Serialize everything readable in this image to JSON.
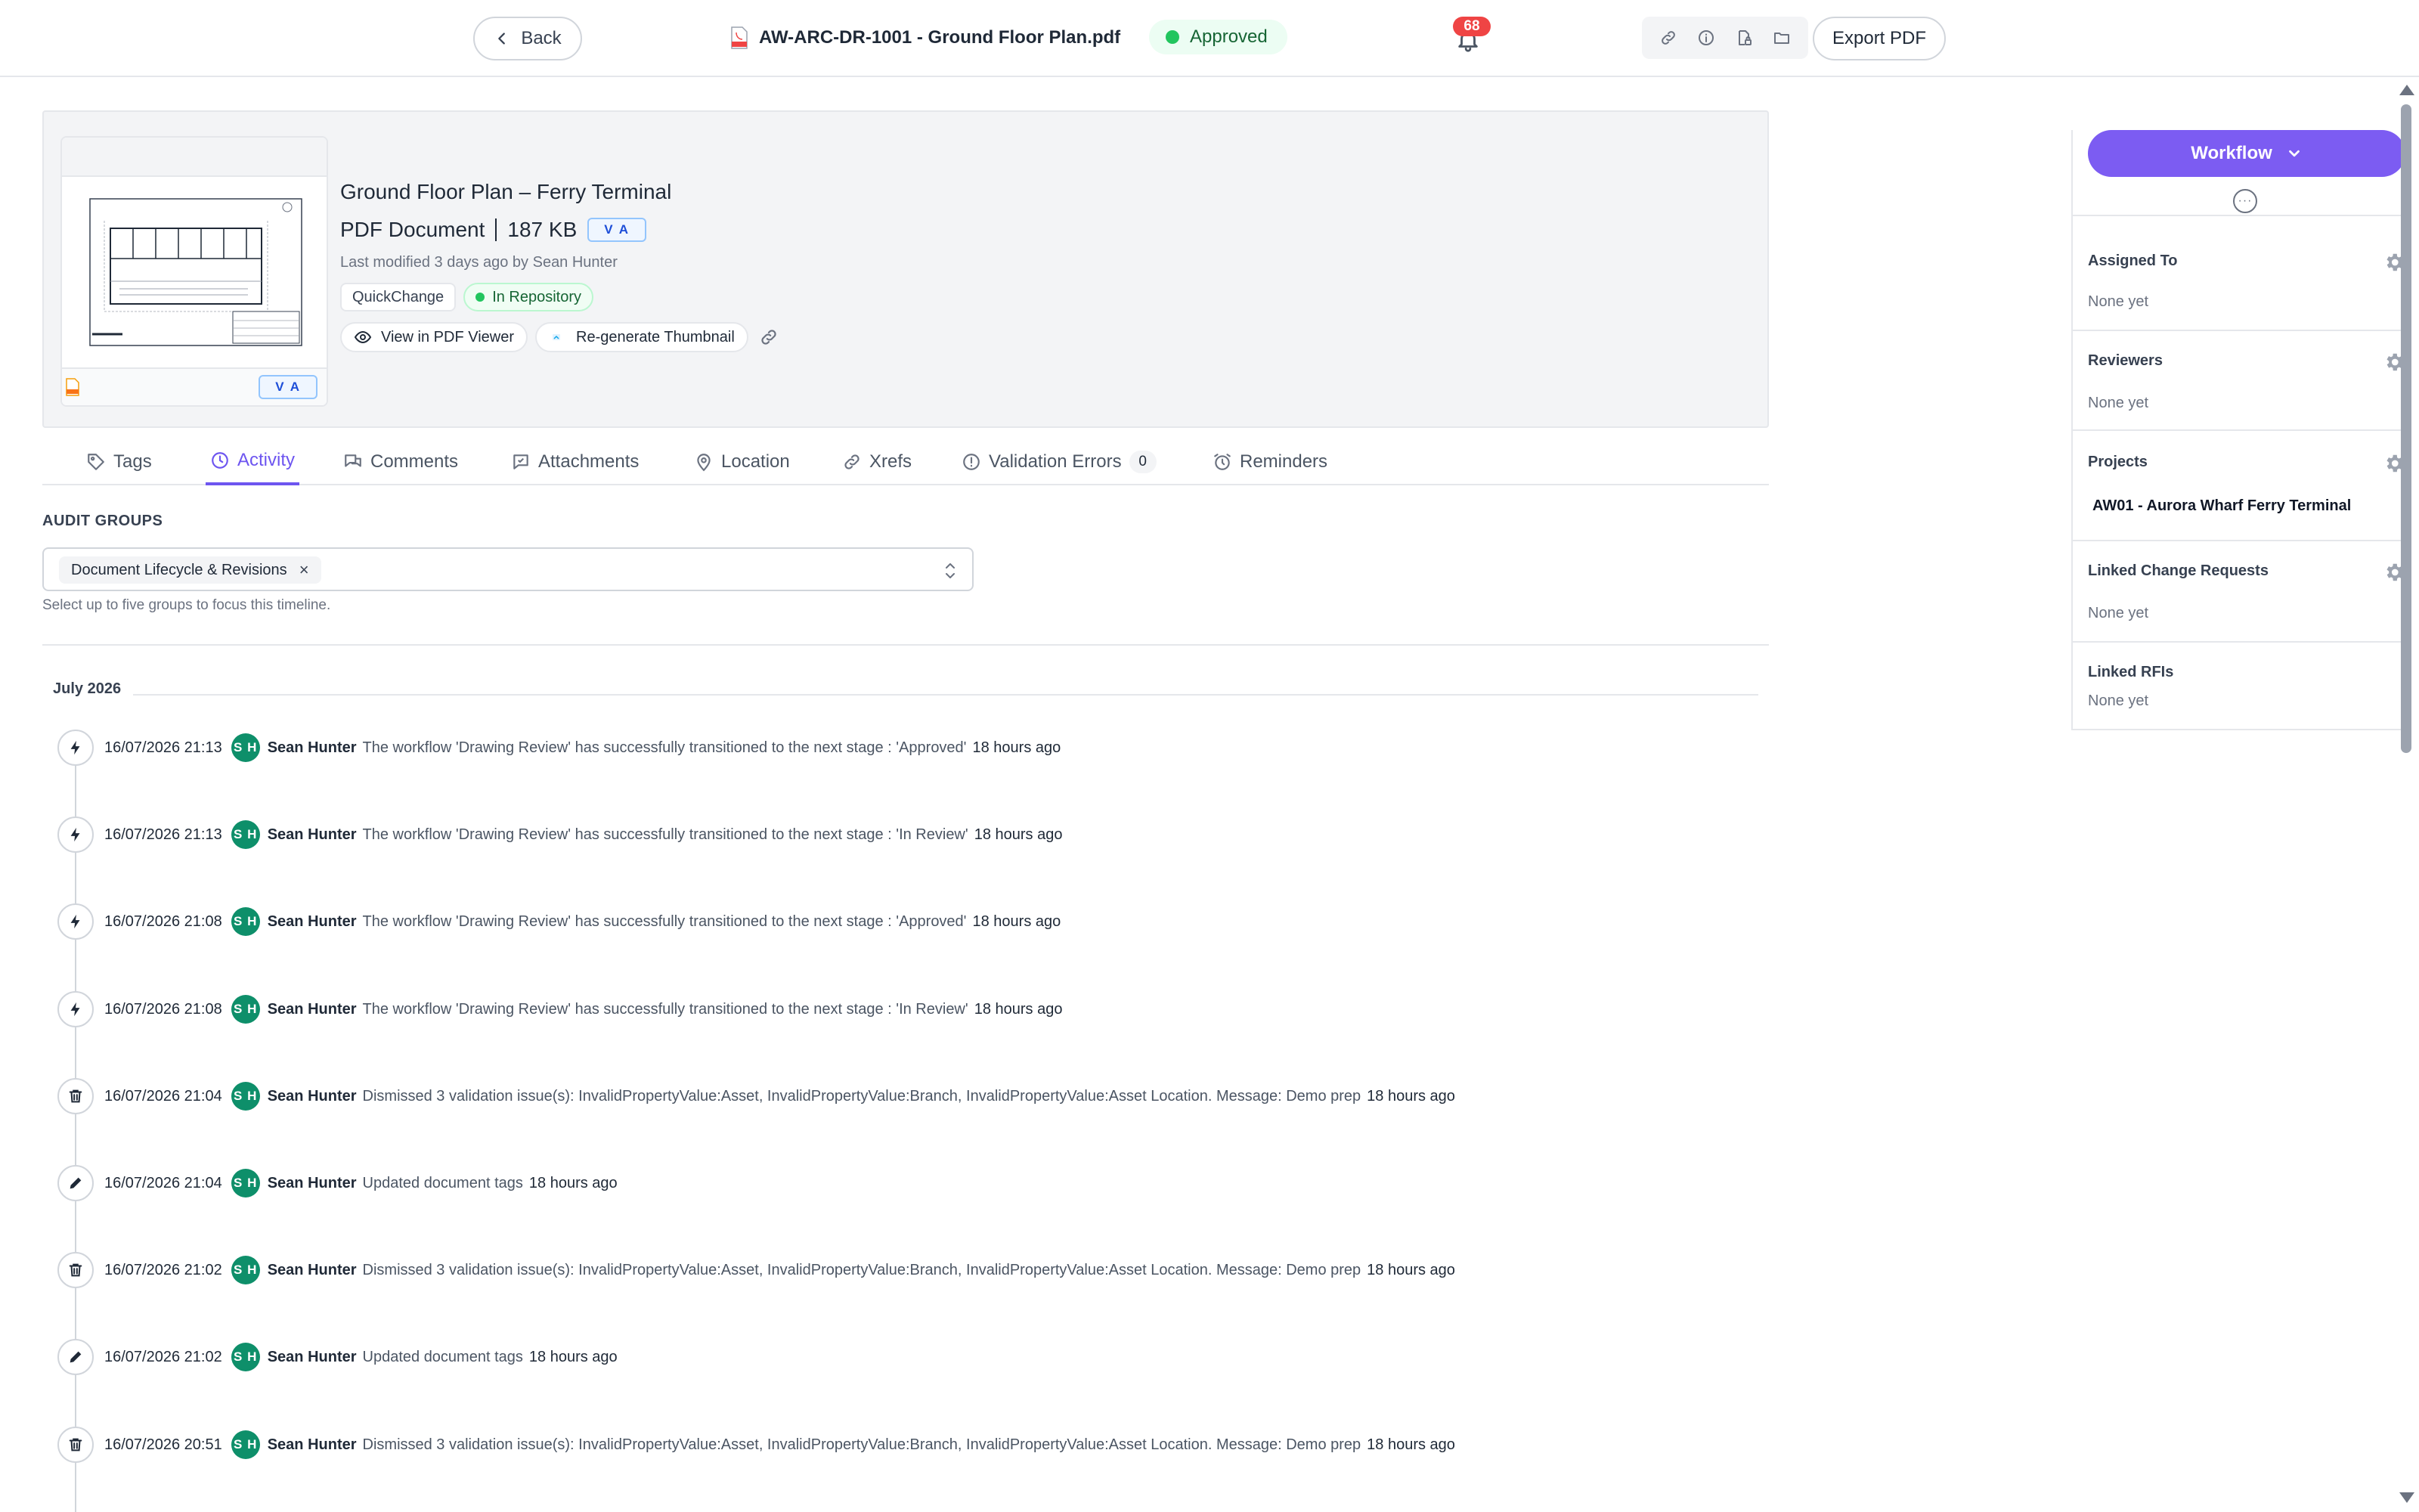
{
  "colors": {
    "accent": "#7c5cf2",
    "approved": "#22c55e",
    "avatar": "#0e8f6a",
    "badge": "#ef4444"
  },
  "topbar": {
    "back_label": "Back",
    "doc_title": "AW-ARC-DR-1001 - Ground Floor Plan.pdf",
    "status": "Approved",
    "notification_count": "68",
    "export_label": "Export PDF",
    "icons": [
      "link-icon",
      "info-icon",
      "file-lock-icon",
      "folder-icon"
    ]
  },
  "document": {
    "title": "Ground Floor Plan – Ferry Terminal",
    "type": "PDF Document",
    "size": "187 KB",
    "version": "V A",
    "modified": "Last modified 3 days ago by Sean Hunter",
    "chips": {
      "quickchange": "QuickChange",
      "repository": "In Repository"
    },
    "actions": {
      "view": "View in PDF Viewer",
      "regenerate": "Re-generate Thumbnail"
    },
    "thumb_version": "V A"
  },
  "tabs": [
    {
      "label": "Tags"
    },
    {
      "label": "Activity"
    },
    {
      "label": "Comments"
    },
    {
      "label": "Attachments"
    },
    {
      "label": "Location"
    },
    {
      "label": "Xrefs"
    },
    {
      "label": "Validation Errors",
      "count": "0"
    },
    {
      "label": "Reminders"
    }
  ],
  "audit": {
    "label": "AUDIT GROUPS",
    "selected": "Document Lifecycle & Revisions",
    "remove": "×",
    "hint": "Select up to five groups to focus this timeline."
  },
  "timeline": {
    "month": "July 2026",
    "entries": [
      {
        "date": "16/07/2026 21:13",
        "initials": "S H",
        "user": "Sean Hunter",
        "message": "The workflow 'Drawing Review' has successfully transitioned to the next stage : 'Approved'",
        "ago": "18 hours ago",
        "icon": "bolt-icon"
      },
      {
        "date": "16/07/2026 21:13",
        "initials": "S H",
        "user": "Sean Hunter",
        "message": "The workflow 'Drawing Review' has successfully transitioned to the next stage : 'In Review'",
        "ago": "18 hours ago",
        "icon": "bolt-icon"
      },
      {
        "date": "16/07/2026 21:08",
        "initials": "S H",
        "user": "Sean Hunter",
        "message": "The workflow 'Drawing Review' has successfully transitioned to the next stage : 'Approved'",
        "ago": "18 hours ago",
        "icon": "bolt-icon"
      },
      {
        "date": "16/07/2026 21:08",
        "initials": "S H",
        "user": "Sean Hunter",
        "message": "The workflow 'Drawing Review' has successfully transitioned to the next stage : 'In Review'",
        "ago": "18 hours ago",
        "icon": "bolt-icon"
      },
      {
        "date": "16/07/2026 21:04",
        "initials": "S H",
        "user": "Sean Hunter",
        "message": "Dismissed 3 validation issue(s): InvalidPropertyValue:Asset, InvalidPropertyValue:Branch, InvalidPropertyValue:Asset Location. Message: Demo prep",
        "ago": "18 hours ago",
        "icon": "trash-icon"
      },
      {
        "date": "16/07/2026 21:04",
        "initials": "S H",
        "user": "Sean Hunter",
        "message": "Updated document tags",
        "ago": "18 hours ago",
        "icon": "pencil-icon"
      },
      {
        "date": "16/07/2026 21:02",
        "initials": "S H",
        "user": "Sean Hunter",
        "message": "Dismissed 3 validation issue(s): InvalidPropertyValue:Asset, InvalidPropertyValue:Branch, InvalidPropertyValue:Asset Location. Message: Demo prep",
        "ago": "18 hours ago",
        "icon": "trash-icon"
      },
      {
        "date": "16/07/2026 21:02",
        "initials": "S H",
        "user": "Sean Hunter",
        "message": "Updated document tags",
        "ago": "18 hours ago",
        "icon": "pencil-icon"
      },
      {
        "date": "16/07/2026 20:51",
        "initials": "S H",
        "user": "Sean Hunter",
        "message": "Dismissed 3 validation issue(s): InvalidPropertyValue:Asset, InvalidPropertyValue:Branch, InvalidPropertyValue:Asset Location. Message: Demo prep",
        "ago": "18 hours ago",
        "icon": "trash-icon"
      }
    ]
  },
  "panel": {
    "workflow_label": "Workflow",
    "more": "···",
    "assigned_label": "Assigned To",
    "assigned_value": "None yet",
    "reviewers_label": "Reviewers",
    "reviewers_value": "None yet",
    "projects_label": "Projects",
    "projects_value": "AW01 - Aurora Wharf Ferry Terminal",
    "change_requests_label": "Linked Change Requests",
    "change_requests_value": "None yet",
    "rfis_label": "Linked RFIs",
    "rfis_value": "None yet"
  }
}
